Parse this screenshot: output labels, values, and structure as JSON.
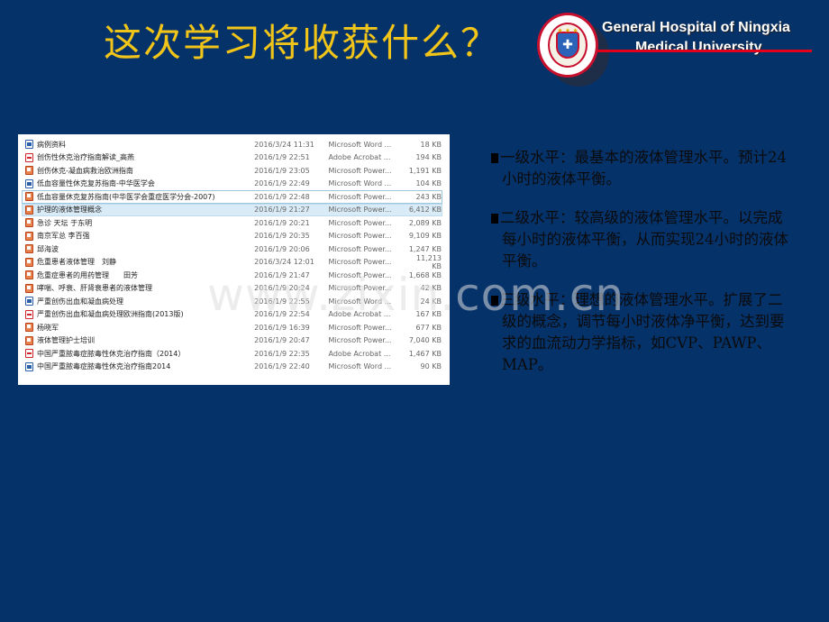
{
  "slide": {
    "title": "这次学习将收获什么？",
    "colors": {
      "background": "#06326a",
      "title": "#f0c419",
      "accent_line": "#e3001b"
    }
  },
  "header": {
    "logo_icon": "hospital-emblem-icon",
    "logo_stars": "★ ★ ★",
    "logo_cross": "✚",
    "hospital_name_line1": "General Hospital of Ningxia",
    "hospital_name_line2": "Medical University"
  },
  "file_list": {
    "rows": [
      {
        "icon": "word",
        "name": "病例资料",
        "date": "2016/3/24 11:31",
        "type": "Microsoft Word ...",
        "size": "18 KB"
      },
      {
        "icon": "pdf",
        "name": "创伤性休克治疗指南解读_高燕",
        "date": "2016/1/9 22:51",
        "type": "Adobe Acrobat ...",
        "size": "194 KB"
      },
      {
        "icon": "ppt",
        "name": "创伤休克-凝血病救治欧洲指南",
        "date": "2016/1/9 23:05",
        "type": "Microsoft Power...",
        "size": "1,191 KB"
      },
      {
        "icon": "word",
        "name": "低血容量性休克复苏指南-中华医学会",
        "date": "2016/1/9 22:49",
        "type": "Microsoft Word ...",
        "size": "104 KB"
      },
      {
        "icon": "ppt",
        "name": "低血容量休克复苏指南(中华医学会重症医学分会-2007)",
        "date": "2016/1/9 22:48",
        "type": "Microsoft Power...",
        "size": "243 KB",
        "state": "focused"
      },
      {
        "icon": "ppt",
        "name": "护理的液体管理概念",
        "date": "2016/1/9 21:27",
        "type": "Microsoft Power...",
        "size": "6,412 KB",
        "state": "selected"
      },
      {
        "icon": "ppt",
        "name": "急诊 天坛 于东明",
        "date": "2016/1/9 20:21",
        "type": "Microsoft Power...",
        "size": "2,089 KB"
      },
      {
        "icon": "ppt",
        "name": "南京军总 李百强",
        "date": "2016/1/9 20:35",
        "type": "Microsoft Power...",
        "size": "9,109 KB"
      },
      {
        "icon": "ppt",
        "name": "邱海波",
        "date": "2016/1/9 20:06",
        "type": "Microsoft Power...",
        "size": "1,247 KB"
      },
      {
        "icon": "ppt",
        "name": "危重患者液体管理　刘静",
        "date": "2016/3/24 12:01",
        "type": "Microsoft Power...",
        "size": "11,213 KB"
      },
      {
        "icon": "ppt",
        "name": "危重症患者的用药管理　　田芳",
        "date": "2016/1/9 21:47",
        "type": "Microsoft Power...",
        "size": "1,668 KB"
      },
      {
        "icon": "ppt",
        "name": "哮喘、呼衰、肝肾衰患者的液体管理",
        "date": "2016/1/9 20:24",
        "type": "Microsoft Power...",
        "size": "42 KB"
      },
      {
        "icon": "word",
        "name": "严重创伤出血和凝血病处理",
        "date": "2016/1/9 22:55",
        "type": "Microsoft Word ...",
        "size": "24 KB"
      },
      {
        "icon": "pdf",
        "name": "严重创伤出血和凝血病处理欧洲指南(2013版)",
        "date": "2016/1/9 22:54",
        "type": "Adobe Acrobat ...",
        "size": "167 KB"
      },
      {
        "icon": "ppt",
        "name": "杨晓军",
        "date": "2016/1/9 16:39",
        "type": "Microsoft Power...",
        "size": "677 KB"
      },
      {
        "icon": "ppt",
        "name": "液体管理护士培训",
        "date": "2016/1/9 20:47",
        "type": "Microsoft Power...",
        "size": "7,040 KB"
      },
      {
        "icon": "pdf",
        "name": "中国严重脓毒症脓毒性休克治疗指南（2014）",
        "date": "2016/1/9 22:35",
        "type": "Adobe Acrobat ...",
        "size": "1,467 KB"
      },
      {
        "icon": "word",
        "name": "中国严重脓毒症脓毒性休克治疗指南2014",
        "date": "2016/1/9 22:40",
        "type": "Microsoft Word ...",
        "size": "90 KB"
      }
    ]
  },
  "bullets": [
    "一级水平：最基本的液体管理水平。预计24小时的液体平衡。",
    "二级水平：较高级的液体管理水平。以完成每小时的液体平衡，从而实现24小时的液体平衡。",
    "三级水平：理想的液体管理水平。扩展了二级的概念，调节每小时液体净平衡，达到要求的血流动力学指标，如CVP、PAWP、MAP。"
  ],
  "watermark": "www.zixin.com.cn"
}
